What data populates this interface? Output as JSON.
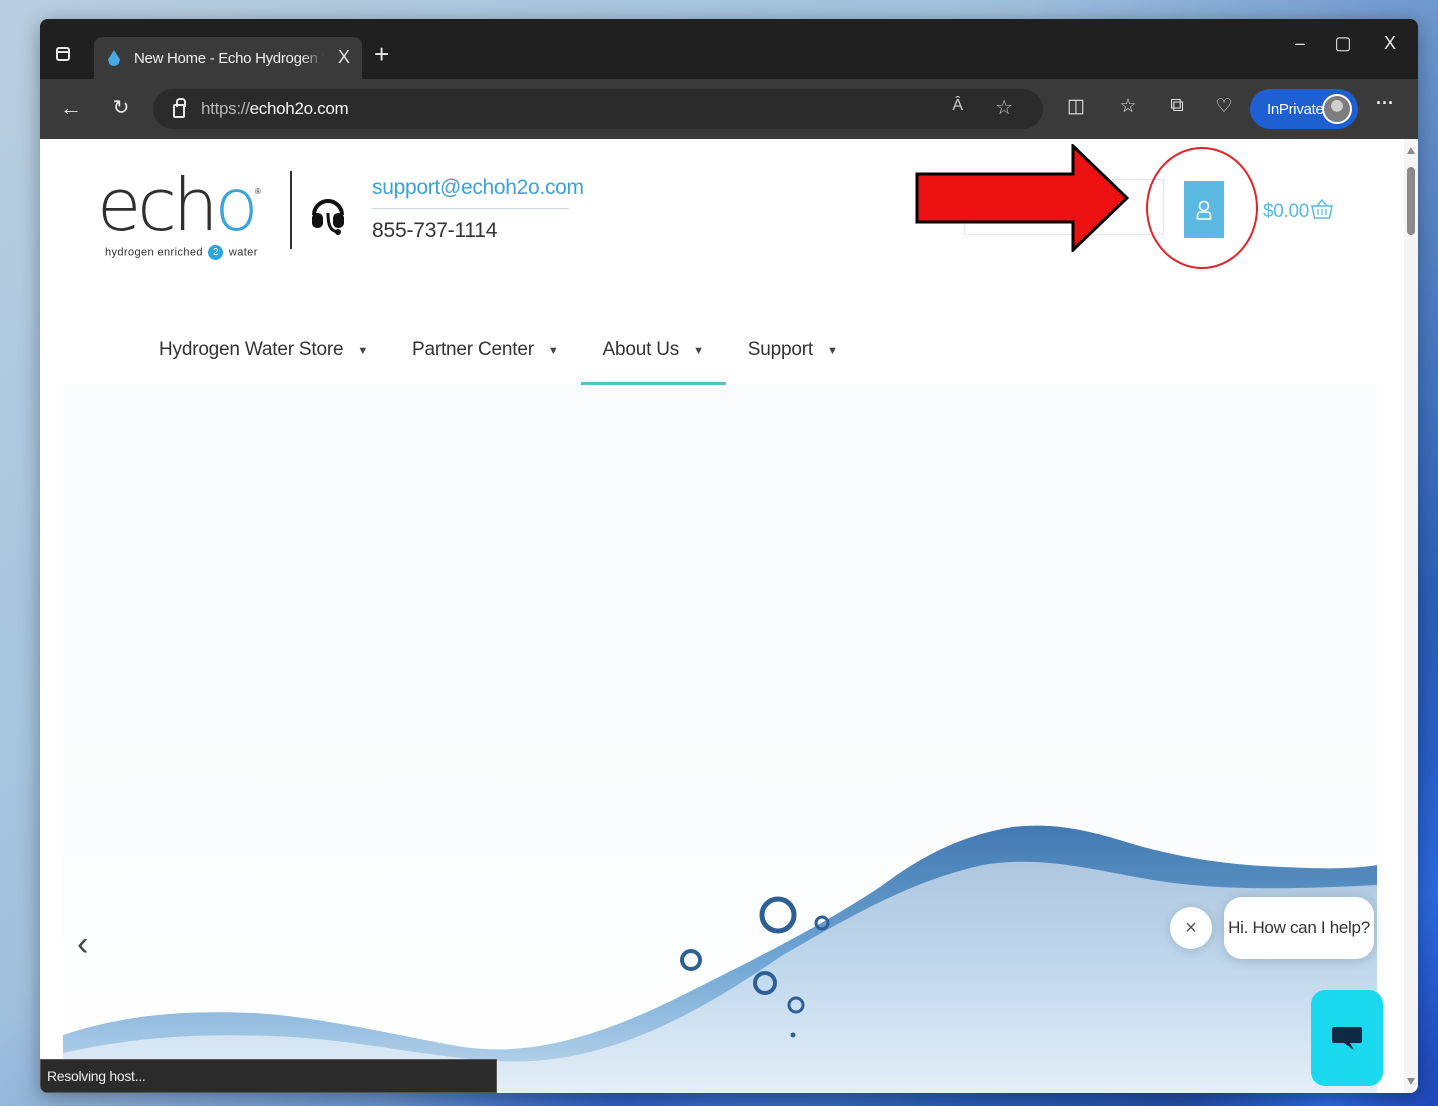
{
  "browser": {
    "tab_title": "New Home - Echo Hydrogen Water",
    "tab_close": "X",
    "new_tab": "+",
    "window_min": "–",
    "window_max": "▢",
    "window_close": "X",
    "url_scheme": "https://",
    "url_host": "echoh2o.com",
    "read_aloud": "Ȃ",
    "inprivate_label": "InPrivate",
    "more": "···",
    "status_text": "Resolving host..."
  },
  "header": {
    "logo_main": "ech",
    "logo_accent": "o",
    "logo_tag_before": "hydrogen enriched",
    "logo_tag_num": "2",
    "logo_tag_after": "water",
    "support_email": "support@echoh2o.com",
    "support_phone": "855-737-1114",
    "cart_total": "$0.00"
  },
  "nav": {
    "items": [
      {
        "label": "Hydrogen Water Store",
        "active": false
      },
      {
        "label": "Partner Center",
        "active": false
      },
      {
        "label": "About Us",
        "active": true
      },
      {
        "label": "Support",
        "active": false
      }
    ],
    "caret": "▼"
  },
  "hero": {
    "prev": "‹"
  },
  "chat": {
    "greeting": "Hi. How can I help?",
    "close": "×"
  },
  "colors": {
    "accent": "#5bb8e0",
    "nav_active": "#56c2c8",
    "chat_launcher": "#1ad9ef",
    "annotation": "#e0232a",
    "inprivate": "#1e5fd1"
  }
}
